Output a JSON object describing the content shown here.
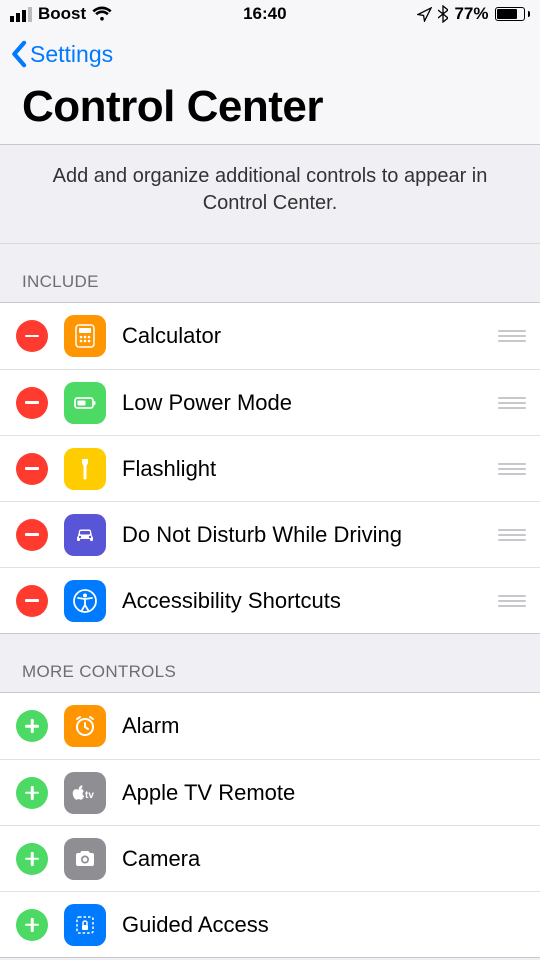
{
  "status": {
    "carrier": "Boost",
    "time": "16:40",
    "battery_pct": "77%",
    "battery_fill": 77
  },
  "nav": {
    "back_label": "Settings"
  },
  "title": "Control Center",
  "description": "Add and organize additional controls to appear in Control Center.",
  "sections": {
    "include_header": "INCLUDE",
    "more_header": "MORE CONTROLS"
  },
  "include": [
    {
      "label": "Calculator",
      "icon": "calculator-icon",
      "bg": "ic-orange"
    },
    {
      "label": "Low Power Mode",
      "icon": "battery-icon",
      "bg": "ic-green"
    },
    {
      "label": "Flashlight",
      "icon": "flashlight-icon",
      "bg": "ic-yellow"
    },
    {
      "label": "Do Not Disturb While Driving",
      "icon": "car-icon",
      "bg": "ic-indigo"
    },
    {
      "label": "Accessibility Shortcuts",
      "icon": "accessibility-icon",
      "bg": "ic-blue"
    }
  ],
  "more": [
    {
      "label": "Alarm",
      "icon": "alarm-icon",
      "bg": "ic-orange"
    },
    {
      "label": "Apple TV Remote",
      "icon": "appletv-icon",
      "bg": "ic-gray"
    },
    {
      "label": "Camera",
      "icon": "camera-icon",
      "bg": "ic-gray"
    },
    {
      "label": "Guided Access",
      "icon": "lock-icon",
      "bg": "ic-blue"
    }
  ]
}
